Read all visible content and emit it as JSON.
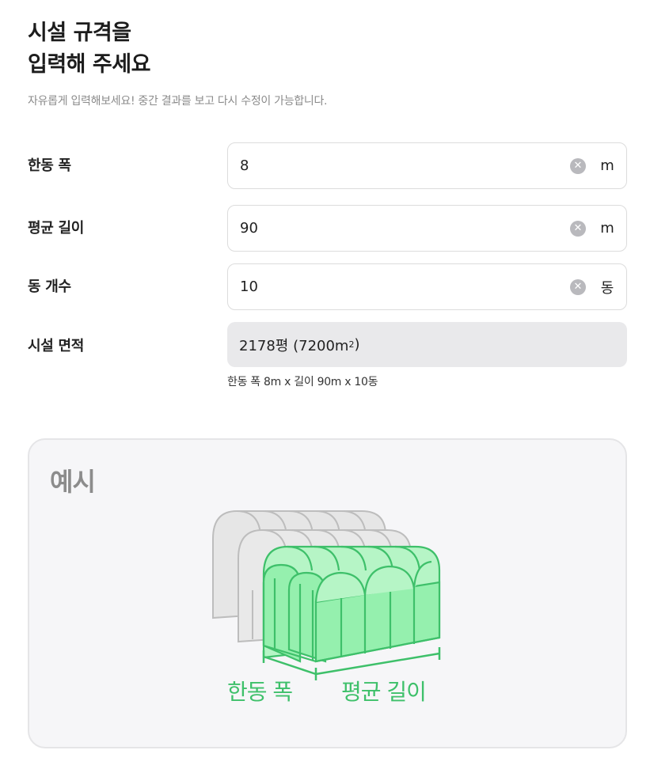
{
  "header": {
    "title_line1": "시설 규격을",
    "title_line2": "입력해 주세요",
    "subtitle": "자유롭게 입력해보세요! 중간 결과를 보고 다시 수정이 가능합니다."
  },
  "form": {
    "width": {
      "label": "한동 폭",
      "value": "8",
      "unit": "m"
    },
    "length": {
      "label": "평균 길이",
      "value": "90",
      "unit": "m"
    },
    "count": {
      "label": "동 개수",
      "value": "10",
      "unit": "동"
    },
    "area": {
      "label": "시설 면적",
      "value_prefix": "2178평 (7200m",
      "value_sup": "2",
      "value_suffix": ")",
      "note": "한동 폭 8m x 길이 90m x 10동"
    }
  },
  "example": {
    "title": "예시",
    "width_label": "한동 폭",
    "length_label": "평균 길이",
    "colors": {
      "highlight": "#8ff0a8",
      "highlight_stroke": "#3ec06a",
      "ghost": "#e4e4e4",
      "ghost_stroke": "#bdbdbd"
    }
  },
  "icons": {
    "clear": "clear-circle-icon"
  }
}
